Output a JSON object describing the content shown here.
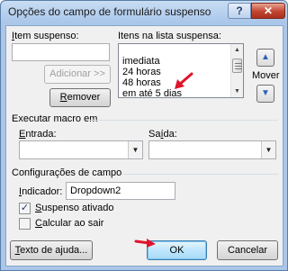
{
  "window": {
    "title": "Opções do campo de formulário suspenso",
    "help_label": "?",
    "close_label": "✕"
  },
  "item_suspenso": {
    "label_accel": "I",
    "label_rest": "tem suspenso:",
    "value": "",
    "add_label": "Adicionar >>",
    "remove_accel": "R",
    "remove_rest": "emover"
  },
  "itens_lista": {
    "label": "Itens na lista suspensa:",
    "items": [
      "imediata",
      "24 horas",
      "48 horas",
      "em até 5 dias"
    ]
  },
  "move": {
    "label": "Mover",
    "up_icon": "arrow-up-icon",
    "down_icon": "arrow-down-icon"
  },
  "macro": {
    "section_label": "Executar macro em",
    "entrada_accel": "E",
    "entrada_rest": "ntrada:",
    "saida_pre": "Sa",
    "saida_accel": "í",
    "saida_rest": "da:",
    "entrada_value": "",
    "saida_value": ""
  },
  "config": {
    "section_label": "Configurações de campo",
    "indicador_accel": "I",
    "indicador_rest": "ndicador:",
    "indicador_value": "Dropdown2",
    "suspenso_accel": "S",
    "suspenso_rest": "uspenso ativado",
    "suspenso_checked": true,
    "calcular_accel": "C",
    "calcular_rest": "alcular ao sair",
    "calcular_checked": false
  },
  "footer": {
    "help_text_accel": "T",
    "help_text_rest": "exto de ajuda...",
    "ok_label": "OK",
    "cancel_label": "Cancelar"
  },
  "colors": {
    "annotation_arrow": "#e0142c"
  }
}
